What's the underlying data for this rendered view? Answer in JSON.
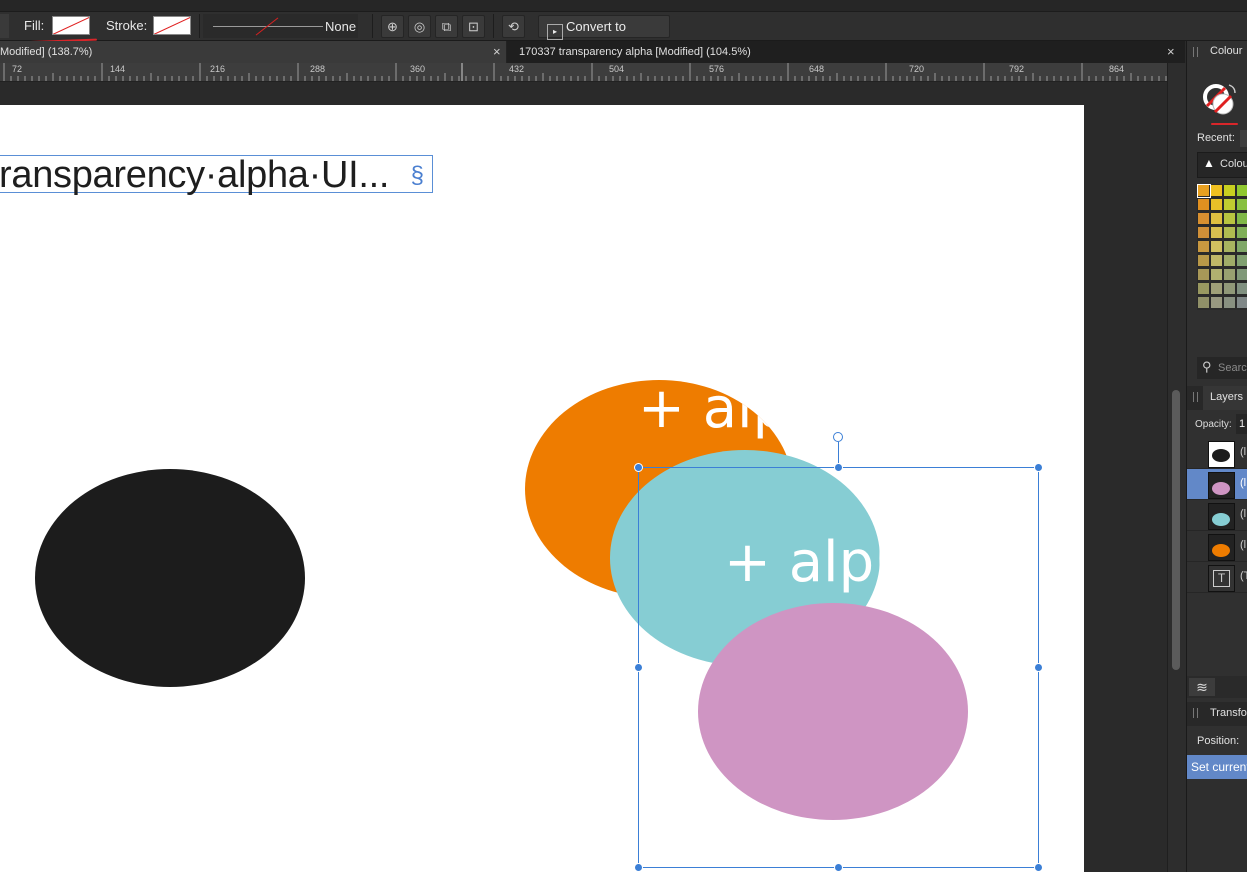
{
  "toolbar": {
    "fill_label": "Fill:",
    "stroke_label": "Stroke:",
    "stroke_style_value": "None",
    "convert_label": "Convert to Curves"
  },
  "tabs": [
    {
      "label": "Modified] (138.7%)"
    },
    {
      "label": "170337 transparency alpha [Modified] (104.5%)"
    }
  ],
  "tab_close_glyph": "×",
  "ruler": {
    "labels": [
      "72",
      "144",
      "216",
      "288",
      "360",
      "432",
      "504",
      "576",
      "648",
      "720",
      "792",
      "864"
    ]
  },
  "canvas": {
    "text_frame": "ransparency·alpha·UI...",
    "text_frame_end_marker": "§",
    "orange_text": "+ alp",
    "teal_text": "+ alpl",
    "colors": {
      "black_ellipse": "#1c1c1c",
      "orange": "#ee7c00",
      "teal": "#86cdd3",
      "pink": "#cf95c3",
      "selection": "#3b7fd6"
    }
  },
  "panel": {
    "colour_tab": "Colour",
    "recent_label": "Recent:",
    "palette_dropdown": "Colou",
    "search_placeholder": "Searc",
    "layers_tab": "Layers",
    "opacity_label": "Opacity:",
    "opacity_value": "1",
    "layers": [
      {
        "label": "(l",
        "kind": "black-ellipse"
      },
      {
        "label": "(l",
        "kind": "pink-ellipse",
        "selected": true
      },
      {
        "label": "(l",
        "kind": "teal-ellipse"
      },
      {
        "label": "(l",
        "kind": "orange-ellipse"
      },
      {
        "label": "(T",
        "kind": "text-frame"
      }
    ],
    "transform_tab": "Transfor",
    "position_label": "Position:",
    "set_current_label": "Set current"
  }
}
